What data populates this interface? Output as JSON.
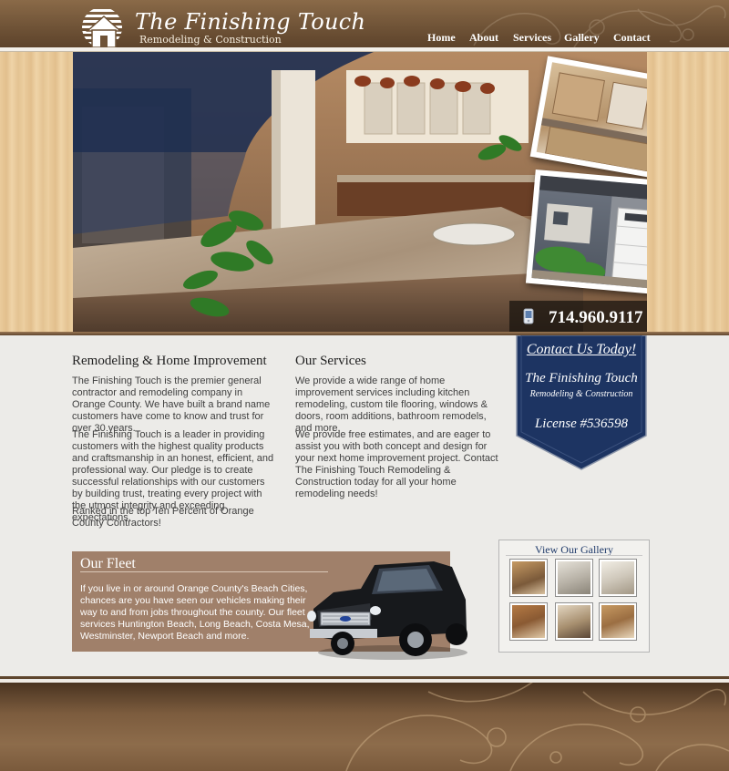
{
  "brand": {
    "name": "The Finishing Touch",
    "tagline": "Remodeling & Construction"
  },
  "nav": {
    "items": [
      {
        "label": "Home"
      },
      {
        "label": "About"
      },
      {
        "label": "Services"
      },
      {
        "label": "Gallery"
      },
      {
        "label": "Contact"
      }
    ]
  },
  "hero": {
    "phone": "714.960.9117"
  },
  "remodeling": {
    "title": "Remodeling & Home Improvement",
    "paragraphs": [
      "The Finishing Touch is the premier general contractor and remodeling company in Orange County. We have built a brand name customers have come to know and trust for over 30 years.",
      "The Finishing Touch is a leader in providing customers with the highest quality products and craftsmanship in an honest, efficient, and professional way. Our pledge is to create successful relationships with our customers by building trust, treating every project with the utmost integrity and exceeding expectations.",
      "Ranked in the top Ten Percent of Orange County Contractors!"
    ]
  },
  "services": {
    "title": "Our Services",
    "paragraphs": [
      "We provide a wide range of home improvement services including kitchen remodeling, custom tile flooring, windows & doors, room additions, bathroom remodels, and more.",
      "We provide free estimates, and are eager to assist you with both concept and design for your next home improvement project. Contact The Finishing Touch Remodeling & Construction today for all your home remodeling needs!"
    ]
  },
  "contact_badge": {
    "cta": "Contact Us Today!",
    "name": "The Finishing Touch",
    "tagline": "Remodeling & Construction",
    "license": "License #536598",
    "color": "#1d3462"
  },
  "fleet": {
    "title": "Our Fleet",
    "text": "If you live in or around Orange County's Beach Cities, chances are you have seen our vehicles making their way to and from jobs throughout the county. Our fleet services Huntington Beach, Long Beach, Costa Mesa, Westminster, Newport Beach and more."
  },
  "gallery": {
    "title": "View Our Gallery"
  },
  "colors": {
    "header_brown": "#6e5236",
    "fleet_brown": "#a0806a",
    "badge_navy": "#1d3462"
  }
}
